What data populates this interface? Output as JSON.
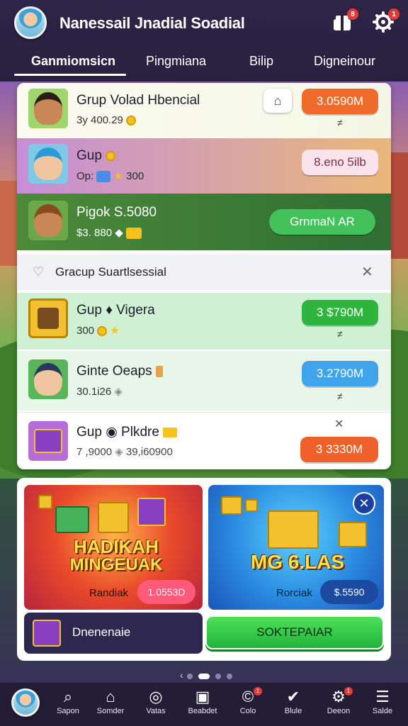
{
  "header": {
    "title": "Nanessail Jnadial Soadial",
    "gift_badge": "8",
    "settings_badge": "1"
  },
  "tabs": [
    {
      "label": "Ganmiomsicn"
    },
    {
      "label": "Pingmiana"
    },
    {
      "label": "Bilip"
    },
    {
      "label": "Digneinour"
    }
  ],
  "list": [
    {
      "title": "Grup Volad Hbencial",
      "sub": "3y 400.29",
      "action": "3.0590M",
      "mark": "≠",
      "color": "#f06a2a"
    },
    {
      "title": "Gup",
      "sub": "Op:",
      "sub_value": "300",
      "action": "8.eno 5ilb",
      "color": "#f7dfe8"
    },
    {
      "title": "Pigok S.5080",
      "sub": "$3. 880",
      "action": "GrnmaN AR",
      "color": "#43c25b"
    },
    {
      "section": "Gracup Suartlsessial"
    },
    {
      "title": "Gup ♦ Vigera",
      "sub": "300",
      "action": "3 $790M",
      "mark": "≠",
      "color": "#2fb53e"
    },
    {
      "title": "Ginte Oeaps",
      "sub": "30.1i26",
      "action": "3.2790M",
      "mark": "≠",
      "color": "#3fa4ec"
    },
    {
      "title": "Gup ◉ Plkdre",
      "sub": "7 ,9000",
      "sub_value": "39,i60900",
      "action": "3 3330M",
      "color": "#f0602a"
    }
  ],
  "promos": {
    "left": {
      "headline_1": "HADIKAH",
      "headline_2": "MINGEUAK",
      "label": "Randiak",
      "pill": "1.0553D"
    },
    "right": {
      "headline": "MG 6.LAS",
      "label": "Rorciak",
      "pill": "$.5590"
    }
  },
  "promo_footer": {
    "left_label": "Dnenenaie",
    "cta": "SOKTEPAIAR"
  },
  "bottom_nav": [
    {
      "label": "Sapon",
      "icon": "search-icon"
    },
    {
      "label": "Somder",
      "icon": "shop-icon"
    },
    {
      "label": "Vatas",
      "icon": "chat-icon"
    },
    {
      "label": "Beabdet",
      "icon": "scroll-icon"
    },
    {
      "label": "Colo",
      "icon": "coin-icon",
      "badge": "1"
    },
    {
      "label": "Blule",
      "icon": "quest-icon"
    },
    {
      "label": "Deeon",
      "icon": "clan-icon",
      "badge": "1"
    },
    {
      "label": "Salde",
      "icon": "menu-icon"
    }
  ]
}
